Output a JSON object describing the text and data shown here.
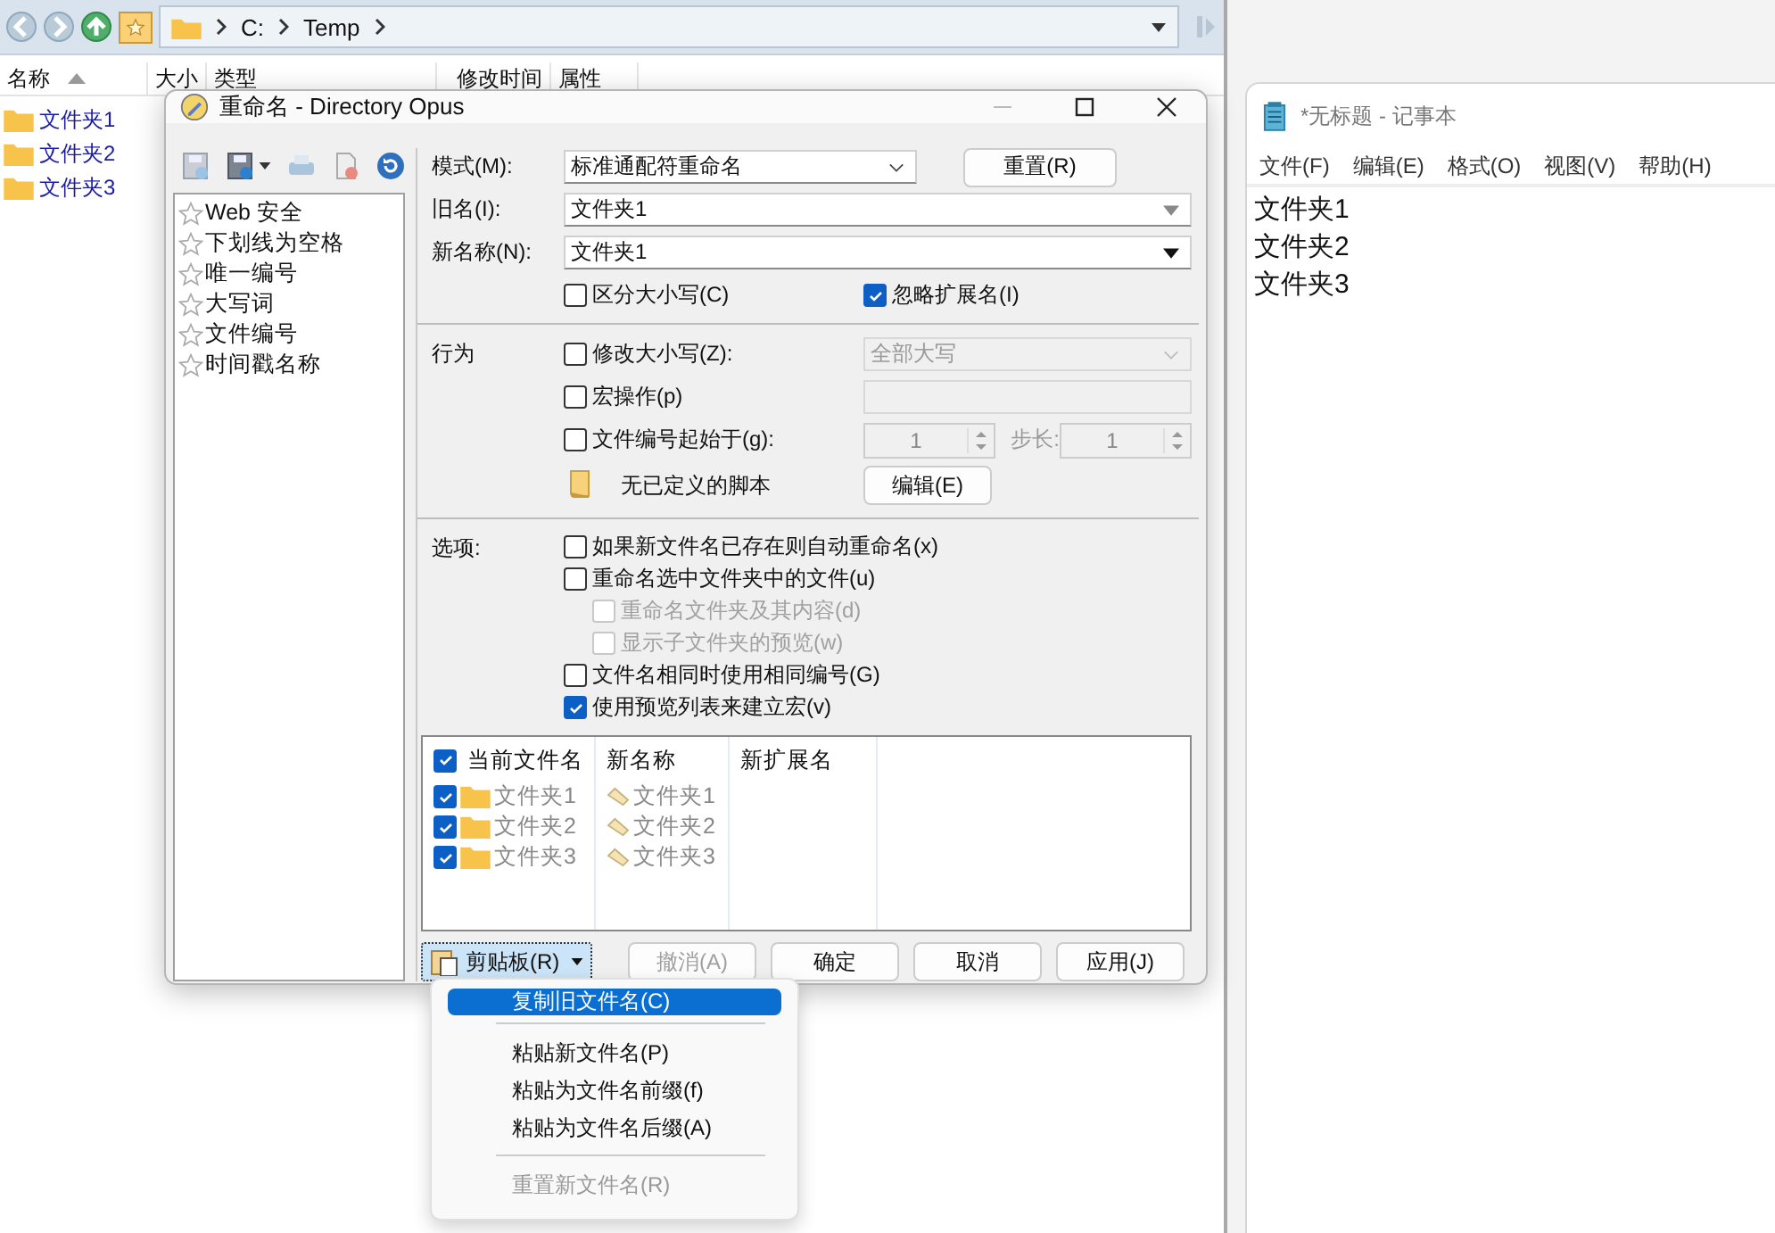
{
  "lister": {
    "path": [
      "C:",
      "Temp"
    ],
    "columns": [
      {
        "label": "名称",
        "sorted": true
      },
      {
        "label": "大小",
        "sorted": false
      },
      {
        "label": "类型",
        "sorted": false
      },
      {
        "label": "修改时间",
        "sorted": false
      },
      {
        "label": "属性",
        "sorted": false
      }
    ],
    "files": [
      "文件夹1",
      "文件夹2",
      "文件夹3"
    ]
  },
  "notepad": {
    "title": "*无标题 - 记事本",
    "menu": [
      "文件(F)",
      "编辑(E)",
      "格式(O)",
      "视图(V)",
      "帮助(H)"
    ],
    "lines": [
      "文件夹1",
      "文件夹2",
      "文件夹3"
    ]
  },
  "rename_dialog": {
    "title": "重命名 - Directory Opus",
    "presets": [
      "Web 安全",
      "下划线为空格",
      "唯一编号",
      "大写词",
      "文件编号",
      "时间戳名称"
    ],
    "mode": {
      "label": "模式(M):",
      "value": "标准通配符重命名"
    },
    "reset_button": "重置(R)",
    "old_name": {
      "label": "旧名(I):",
      "value": "文件夹1"
    },
    "new_name": {
      "label": "新名称(N):",
      "value": "文件夹1"
    },
    "case_sensitive": {
      "label": "区分大小写(C)",
      "checked": false
    },
    "ignore_extension": {
      "label": "忽略扩展名(I)",
      "checked": true
    },
    "behavior": {
      "label": "行为",
      "change_case": {
        "label": "修改大小写(Z):",
        "checked": false,
        "value": "全部大写"
      },
      "macro": {
        "label": "宏操作(p)",
        "checked": false
      },
      "numbering": {
        "label": "文件编号起始于(g):",
        "checked": false,
        "start": "1",
        "step_label": "步长:",
        "step": "1"
      },
      "script": {
        "text": "无已定义的脚本",
        "button": "编辑(E)"
      }
    },
    "options": {
      "label": "选项:",
      "items": [
        {
          "label": "如果新文件名已存在则自动重命名(x)",
          "checked": false,
          "disabled": false
        },
        {
          "label": "重命名选中文件夹中的文件(u)",
          "checked": false,
          "disabled": false,
          "children": [
            {
              "label": "重命名文件夹及其内容(d)",
              "checked": false,
              "disabled": true
            },
            {
              "label": "显示子文件夹的预览(w)",
              "checked": false,
              "disabled": true
            }
          ]
        },
        {
          "label": "文件名相同时使用相同编号(G)",
          "checked": false,
          "disabled": false
        },
        {
          "label": "使用预览列表来建立宏(v)",
          "checked": true,
          "disabled": false
        }
      ]
    },
    "preview": {
      "columns": [
        "当前文件名",
        "新名称",
        "新扩展名"
      ],
      "all_checked": true,
      "rows": [
        {
          "old": "文件夹1",
          "new": "文件夹1",
          "checked": true
        },
        {
          "old": "文件夹2",
          "new": "文件夹2",
          "checked": true
        },
        {
          "old": "文件夹3",
          "new": "文件夹3",
          "checked": true
        }
      ]
    },
    "clipboard_button": "剪贴板(R)",
    "buttons": [
      {
        "label": "撤消(A)",
        "disabled": true
      },
      {
        "label": "确定",
        "disabled": false
      },
      {
        "label": "取消",
        "disabled": false
      },
      {
        "label": "应用(J)",
        "disabled": false
      }
    ]
  },
  "clipboard_menu": [
    {
      "kind": "item",
      "label": "复制旧文件名(C)",
      "selected": true,
      "disabled": false
    },
    {
      "kind": "separator"
    },
    {
      "kind": "item",
      "label": "粘贴新文件名(P)",
      "selected": false,
      "disabled": false
    },
    {
      "kind": "item",
      "label": "粘贴为文件名前缀(f)",
      "selected": false,
      "disabled": false
    },
    {
      "kind": "item",
      "label": "粘贴为文件名后缀(A)",
      "selected": false,
      "disabled": false
    },
    {
      "kind": "separator"
    },
    {
      "kind": "item",
      "label": "重置新文件名(R)",
      "selected": false,
      "disabled": true
    }
  ]
}
